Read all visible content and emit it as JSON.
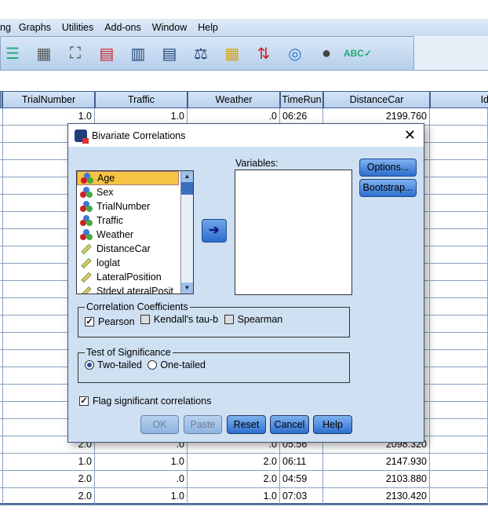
{
  "menu": [
    "ng",
    "Graphs",
    "Utilities",
    "Add-ons",
    "Window",
    "Help"
  ],
  "toolbar_icons": [
    "variables-icon",
    "value-labels-icon",
    "find-icon",
    "insert-cases-icon",
    "insert-variable-icon",
    "split-file-icon",
    "weight-cases-icon",
    "select-cases-icon",
    "value-labels-toggle-icon",
    "use-sets-icon",
    "show-all-variables-icon",
    "spell-check-icon"
  ],
  "grid": {
    "columns": [
      "",
      "TrialNumber",
      "Traffic",
      "Weather",
      "TimeRun",
      "DistanceCar",
      "Id"
    ],
    "first_row": [
      "",
      "1.0",
      "1.0",
      ".0",
      "06:26",
      "2199.760",
      ""
    ],
    "bottom_rows": [
      [
        "",
        "2.0",
        ".0",
        ".0",
        "05:56",
        "2098.320",
        ""
      ],
      [
        "",
        "1.0",
        "1.0",
        "2.0",
        "06:11",
        "2147.930",
        ""
      ],
      [
        "",
        "2.0",
        ".0",
        "2.0",
        "04:59",
        "2103.880",
        ""
      ],
      [
        "",
        "2.0",
        "1.0",
        "1.0",
        "07:03",
        "2130.420",
        ""
      ]
    ],
    "hidden_edge": "0"
  },
  "dialog": {
    "title": "Bivariate Correlations",
    "source_vars": [
      {
        "name": "Age",
        "type": "nominal",
        "selected": true
      },
      {
        "name": "Sex",
        "type": "nominal"
      },
      {
        "name": "TrialNumber",
        "type": "nominal"
      },
      {
        "name": "Traffic",
        "type": "nominal"
      },
      {
        "name": "Weather",
        "type": "nominal"
      },
      {
        "name": "DistanceCar",
        "type": "scale"
      },
      {
        "name": "loglat",
        "type": "scale"
      },
      {
        "name": "LateralPosition",
        "type": "scale"
      },
      {
        "name": "StdevLateralPosit",
        "type": "scale"
      }
    ],
    "variables_label": "Variables:",
    "options": "Options...",
    "bootstrap": "Bootstrap...",
    "coef_legend": "Correlation Coefficients",
    "pearson": "Pearson",
    "pearson_checked": true,
    "kendall": "Kendall's tau-b",
    "kendall_checked": false,
    "spearman": "Spearman",
    "spearman_checked": false,
    "sig_legend": "Test of Significance",
    "two_tailed": "Two-tailed",
    "one_tailed": "One-tailed",
    "selected_test": "Two-tailed",
    "flag": "Flag significant correlations",
    "flag_checked": true,
    "ok": "OK",
    "paste": "Paste",
    "reset": "Reset",
    "cancel": "Cancel",
    "help": "Help"
  }
}
